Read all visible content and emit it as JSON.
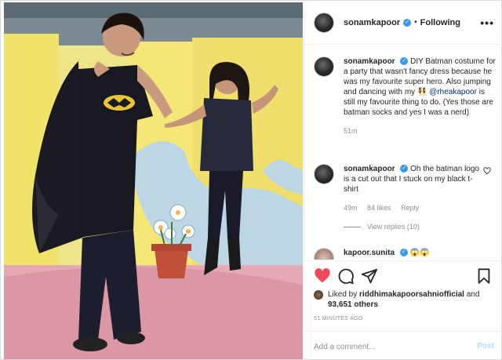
{
  "post": {
    "author": "sonamkapoor",
    "verified_glyph": "✓",
    "separator": "•",
    "follow_status": "Following",
    "more_glyph": "•••"
  },
  "comments": [
    {
      "user": "sonamkapoor",
      "text_1": "DIY Batman costume for a party that wasn't fancy dress because he was my favourite super hero. Also jumping and dancing with my 👯‍♀️",
      "mention": "@rheakapoor",
      "text_2": "is still my favourite thing to do. (Yes those are batman socks and yes I was a nerd)",
      "time": "51m"
    },
    {
      "user": "sonamkapoor",
      "text": "Oh the batman logo is a cut out that I stuck on my black t-shirt",
      "time": "49m",
      "likes": "84 likes",
      "reply": "Reply",
      "view_replies": "View replies (10)"
    },
    {
      "user": "kapoor.sunita",
      "text": "😱😱"
    }
  ],
  "actions": {
    "like_icon": "heart-filled-icon",
    "comment_icon": "comment-bubble-icon",
    "share_icon": "paper-plane-icon",
    "save_icon": "bookmark-icon",
    "liked_by_prefix": "Liked by",
    "liked_by_user": "riddhimakapoorsahniofficial",
    "liked_by_and": "and",
    "liked_by_others": "93,651 others",
    "timestamp": "51 MINUTES AGO"
  },
  "add_comment": {
    "placeholder": "Add a comment...",
    "post_label": "Post"
  },
  "colors": {
    "heart": "#ed4956",
    "mention": "#003569",
    "verified": "#3897f0",
    "post_disabled": "#b2dffc"
  }
}
